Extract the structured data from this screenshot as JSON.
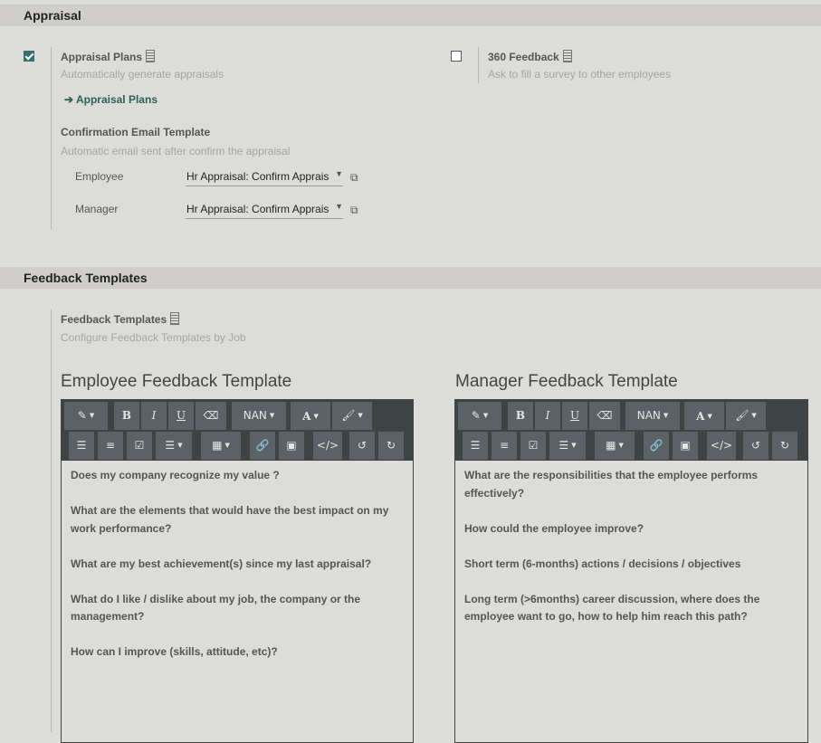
{
  "appraisal": {
    "section_title": "Appraisal",
    "plans": {
      "label": "Appraisal Plans",
      "help": "Automatically generate appraisals",
      "checked": true,
      "link": "Appraisal Plans"
    },
    "feedback360": {
      "label": "360 Feedback",
      "help": "Ask to fill a survey to other employees",
      "checked": false
    },
    "confirmation": {
      "label": "Confirmation Email Template",
      "help": "Automatic email sent after confirm the appraisal",
      "employee": {
        "label": "Employee",
        "value": "Hr Appraisal: Confirm Appraisal"
      },
      "manager": {
        "label": "Manager",
        "value": "Hr Appraisal: Confirm Appraisal"
      }
    }
  },
  "feedback": {
    "section_title": "Feedback Templates",
    "label": "Feedback Templates",
    "help": "Configure Feedback Templates by Job",
    "employee_template": {
      "title": "Employee Feedback Template",
      "lines": [
        "Does my company recognize my value ?",
        "What are the elements that would have the best impact on my work performance?",
        "What are my best achievement(s) since my last appraisal?",
        "What do I like / dislike about my job, the company or the management?",
        "How can I improve (skills, attitude, etc)?"
      ]
    },
    "manager_template": {
      "title": "Manager Feedback Template",
      "lines": [
        "What are the responsibilities that the employee performs effectively?",
        "How could the employee improve?",
        "Short term (6-months) actions / decisions / objectives",
        "Long term (>6months) career discussion, where does the employee want to go, how to help him reach this path?"
      ]
    }
  },
  "toolbar": {
    "font_size": "NAN"
  },
  "colors": {
    "accent": "#35716b",
    "section_bar": "#cfceca",
    "background": "#dcdcd9",
    "toolbar": "#3e4446"
  }
}
